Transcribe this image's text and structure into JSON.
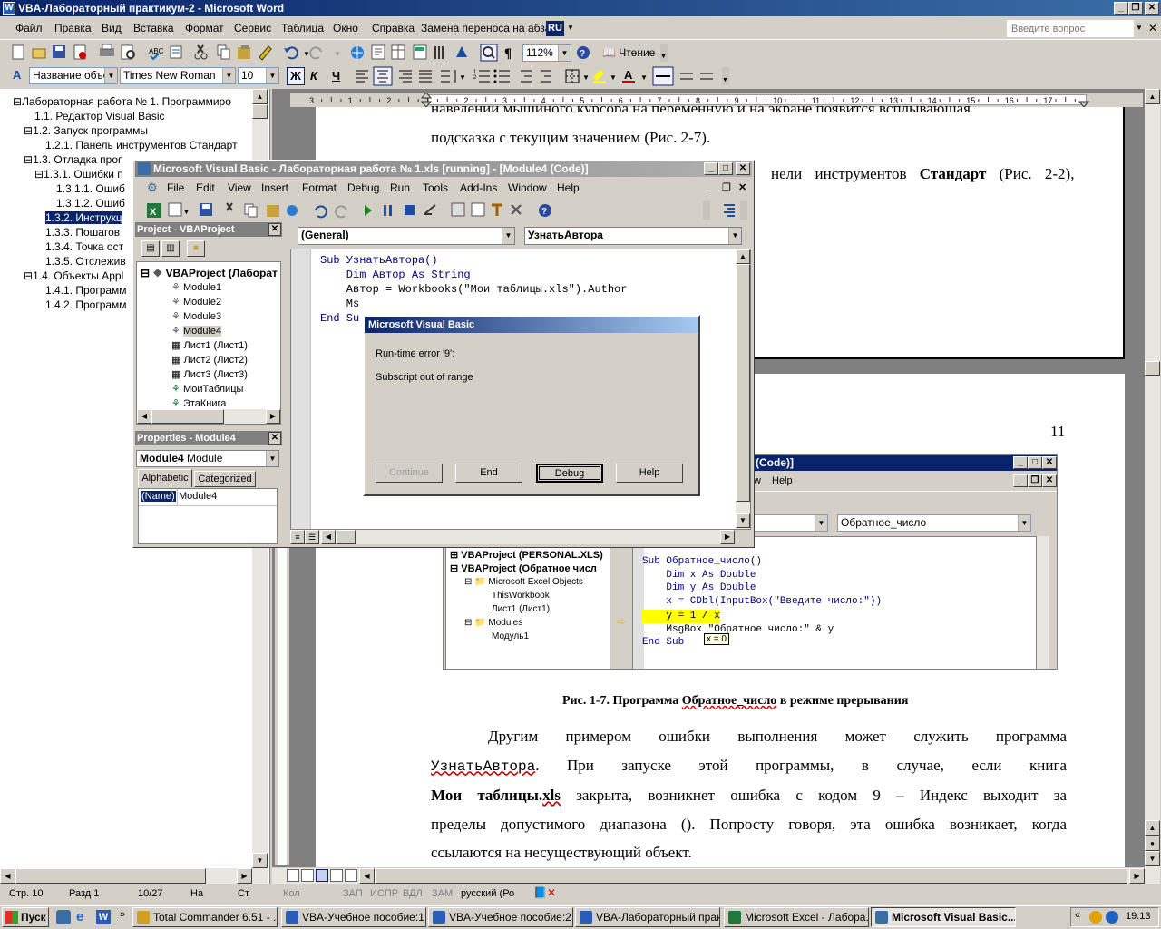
{
  "word": {
    "title": "VBA-Лабораторный практикум-2 - Microsoft Word",
    "menu": [
      "Файл",
      "Правка",
      "Вид",
      "Вставка",
      "Формат",
      "Сервис",
      "Таблица",
      "Окно",
      "Справка",
      "Замена переноса на абзац"
    ],
    "lang_badge": "RU",
    "help_placeholder": "Введите вопрос",
    "zoom": "112%",
    "reading_label": "Чтение",
    "style_value": "Название объек",
    "font_value": "Times New Roman",
    "size_value": "10",
    "bold": "Ж",
    "italic": "К",
    "underline": "Ч"
  },
  "outline": [
    "Лабораторная работа № 1. Программиро",
    "1.1. Редактор Visual Basic",
    "1.2. Запуск программы",
    "1.2.1. Панель инструментов Стандарт",
    "1.3. Отладка прог",
    "1.3.1. Ошибки п",
    "1.3.1.1. Ошиб",
    "1.3.1.2. Ошиб",
    "1.3.2. Инструкц",
    "1.3.3. Пошагов",
    "1.3.4. Точка ост",
    "1.3.5. Отслежив",
    "1.4. Объекты Appl",
    "1.4.1. Программ",
    "1.4.2. Программ"
  ],
  "ruler_marks": [
    "3",
    "1",
    "2",
    "1",
    "2",
    "3",
    "4",
    "5",
    "6",
    "7",
    "8",
    "9",
    "10",
    "11",
    "12",
    "13",
    "14",
    "15",
    "16",
    "17"
  ],
  "doc": {
    "top_line1": "наведении мышиного курсора на переменную и на экране появится всплывающая",
    "top_line2": "подсказка с текущим значением (Рис. 2-7).",
    "top_line3a": "нели инструментов ",
    "top_line3b": "Стандарт",
    "top_line3c": " (Рис. 2-2),",
    "page_number": "11",
    "caption_a": "Рис. 1-7. Программа ",
    "caption_b": "Обратное_число",
    "caption_c": " в режиме прерывания",
    "para1": "Другим примером ошибки выполнения может служить программа",
    "para2a": "УзнатьАвтора",
    "para2b": ". При запуске этой программы, в случае, если книга",
    "para3a": "Мои таблицы.",
    "para3b": "xls",
    "para3c": " закрыта, возникнет ошибка с кодом 9 – Индекс выходит за",
    "para4": "пределы допустимого диапазона (). Попросту говоря, эта ошибка возникает, когда",
    "para5": "ссылаются на несуществующий объект."
  },
  "figure": {
    "title": "(Code)]",
    "menu": [
      "w",
      "Help"
    ],
    "combo_right": "Обратное_число",
    "tree": [
      "VBAProject (PERSONAL.XLS)",
      "VBAProject (Обратное числ",
      "Microsoft Excel Objects",
      "ThisWorkbook",
      "Лист1 (Лист1)",
      "Modules",
      "Модуль1"
    ],
    "code": [
      "Sub Обратное_число()",
      "    Dim x As Double",
      "    Dim y As Double",
      "",
      "    x = CDbl(InputBox(\"Введите число:\"))",
      "    y = 1 / x",
      "    MsgBox \"Обратное число:\" & y",
      "",
      "End Sub"
    ],
    "tooltip": "x = 0"
  },
  "vbe": {
    "title": "Microsoft Visual Basic - Лабораторная работа № 1.xls [running] - [Module4 (Code)]",
    "menu": [
      "File",
      "Edit",
      "View",
      "Insert",
      "Format",
      "Debug",
      "Run",
      "Tools",
      "Add-Ins",
      "Window",
      "Help"
    ],
    "project_title": "Project - VBAProject",
    "project_tree": [
      "VBAProject (Лаборат",
      "Module1",
      "Module2",
      "Module3",
      "Module4",
      "Лист1 (Лист1)",
      "Лист2 (Лист2)",
      "Лист3 (Лист3)",
      "МоиТаблицы",
      "ЭтаКнига"
    ],
    "properties_title": "Properties - Module4",
    "properties_combo_name": "Module4",
    "properties_combo_type": "Module",
    "tab_alpha": "Alphabetic",
    "tab_cat": "Categorized",
    "prop_name": "(Name)",
    "prop_value": "Module4",
    "combo_general": "(General)",
    "combo_proc": "УзнатьАвтора",
    "code": [
      "Sub УзнатьАвтора()",
      "    Dim Автор As String",
      "",
      "    Автор = Workbooks(\"Мои таблицы.xls\").Author",
      "    Ms",
      "",
      "End Su"
    ]
  },
  "dialog": {
    "title": "Microsoft Visual Basic",
    "line1": "Run-time error '9':",
    "line2": "Subscript out of range",
    "btn_continue": "Continue",
    "btn_end": "End",
    "btn_debug": "Debug",
    "btn_help": "Help"
  },
  "status": {
    "page": "Стр. 10",
    "section": "Разд 1",
    "pages": "10/27",
    "at": "На",
    "col": "Ст",
    "kol": "Кол",
    "zap": "ЗАП",
    "ispr": "ИСПР",
    "vdl": "ВДЛ",
    "zam": "ЗАМ",
    "lang": "русский (Ро"
  },
  "taskbar": {
    "start": "Пуск",
    "items": [
      "Total Commander 6.51 - ...",
      "VBA-Учебное пособие:1...",
      "VBA-Учебное пособие:2...",
      "VBA-Лабораторный прак...",
      "Microsoft Excel - Лабора...",
      "Microsoft Visual Basic..."
    ],
    "clock": "19:13"
  },
  "colors": {
    "titlebar": "#0a246a",
    "titlebar_inactive": "#808080",
    "highlight": "#0a246a",
    "yellow": "#ffff00"
  }
}
